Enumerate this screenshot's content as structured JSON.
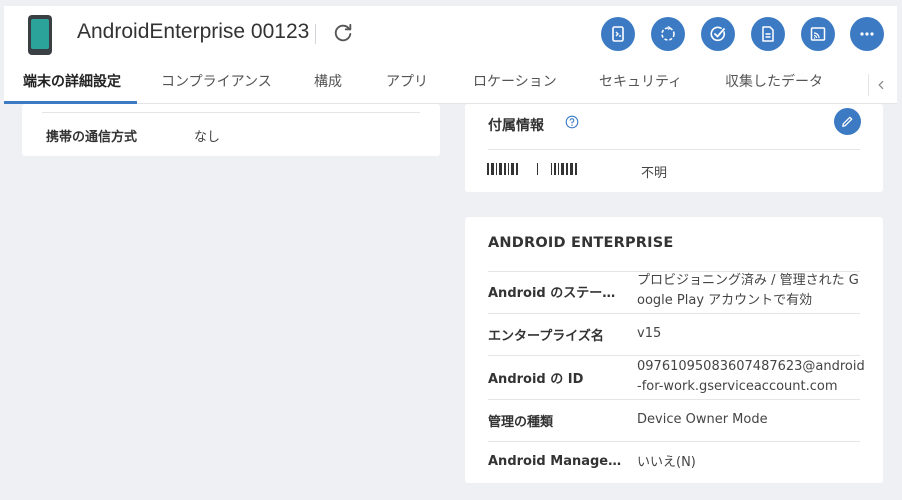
{
  "header": {
    "device_name": "AndroidEnterprise 00123",
    "actions": [
      {
        "name": "remote-control-icon"
      },
      {
        "name": "sync-icon"
      },
      {
        "name": "check-icon"
      },
      {
        "name": "document-icon"
      },
      {
        "name": "cast-icon"
      },
      {
        "name": "more-icon"
      }
    ]
  },
  "tabs": [
    {
      "label": "端末の詳細設定",
      "active": true
    },
    {
      "label": "コンプライアンス"
    },
    {
      "label": "構成"
    },
    {
      "label": "アプリ"
    },
    {
      "label": "ロケーション"
    },
    {
      "label": "セキュリティ"
    },
    {
      "label": "収集したデータ"
    }
  ],
  "left_card": {
    "label": "携帯の通信方式",
    "value": "なし"
  },
  "accessory_card": {
    "title": "付属情報",
    "value": "不明"
  },
  "android_enterprise": {
    "title": "ANDROID ENTERPRISE",
    "rows": [
      {
        "label": "Android のステー…",
        "value": "プロビジョニング済み / 管理された Google Play アカウントで有効"
      },
      {
        "label": "エンタープライズ名",
        "value": "v15"
      },
      {
        "label": "Android の ID",
        "value": "09761095083607487623@android-for-work.gserviceaccount.com"
      },
      {
        "label": "管理の種類",
        "value": "Device Owner Mode"
      },
      {
        "label": "Android Manage…",
        "value": "いいえ(N)"
      }
    ]
  },
  "colors": {
    "accent": "#3c7bc4",
    "device_screen": "#2ba39a",
    "background": "#eef0f3"
  }
}
